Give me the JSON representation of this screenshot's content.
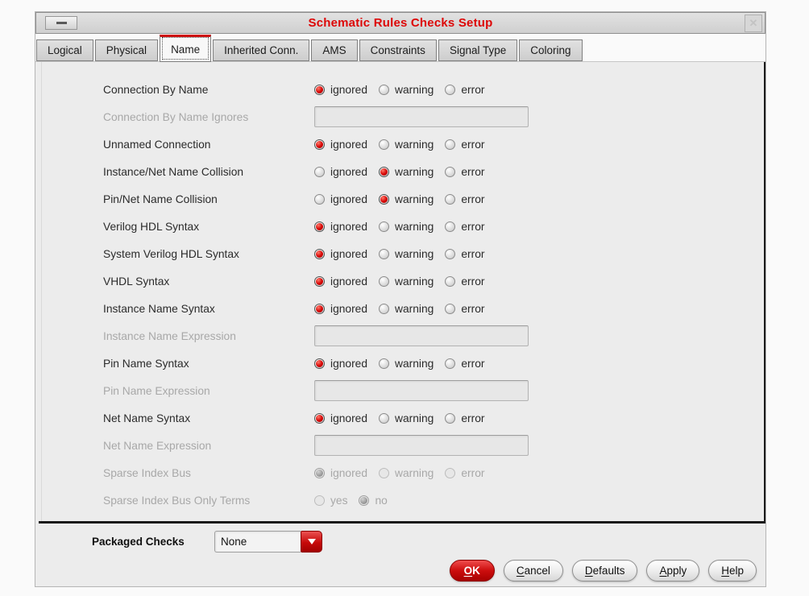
{
  "window": {
    "title": "Schematic Rules Checks Setup"
  },
  "icons": {
    "minimize": "–",
    "close": "✕",
    "dropdown_arrow": "▼"
  },
  "colors": {
    "accent_red": "#cc0000",
    "title_text": "#dd0707",
    "primary_button": "#c60909",
    "disabled_text": "#a8a8a8"
  },
  "tabs": [
    {
      "label": "Logical",
      "active": false
    },
    {
      "label": "Physical",
      "active": false
    },
    {
      "label": "Name",
      "active": true
    },
    {
      "label": "Inherited Conn.",
      "active": false
    },
    {
      "label": "AMS",
      "active": false
    },
    {
      "label": "Constraints",
      "active": false
    },
    {
      "label": "Signal Type",
      "active": false
    },
    {
      "label": "Coloring",
      "active": false
    }
  ],
  "severity_options": [
    "ignored",
    "warning",
    "error"
  ],
  "rows": [
    {
      "type": "radio",
      "label": "Connection By Name",
      "selected": "ignored",
      "enabled": true
    },
    {
      "type": "field",
      "label": "Connection By Name Ignores",
      "value": "",
      "enabled": false
    },
    {
      "type": "radio",
      "label": "Unnamed Connection",
      "selected": "ignored",
      "enabled": true
    },
    {
      "type": "radio",
      "label": "Instance/Net Name Collision",
      "selected": "warning",
      "enabled": true
    },
    {
      "type": "radio",
      "label": "Pin/Net Name Collision",
      "selected": "warning",
      "enabled": true
    },
    {
      "type": "radio",
      "label": "Verilog HDL Syntax",
      "selected": "ignored",
      "enabled": true
    },
    {
      "type": "radio",
      "label": "System Verilog HDL Syntax",
      "selected": "ignored",
      "enabled": true
    },
    {
      "type": "radio",
      "label": "VHDL Syntax",
      "selected": "ignored",
      "enabled": true
    },
    {
      "type": "radio",
      "label": "Instance Name Syntax",
      "selected": "ignored",
      "enabled": true
    },
    {
      "type": "field",
      "label": "Instance Name Expression",
      "value": "",
      "enabled": false
    },
    {
      "type": "radio",
      "label": "Pin Name Syntax",
      "selected": "ignored",
      "enabled": true
    },
    {
      "type": "field",
      "label": "Pin Name Expression",
      "value": "",
      "enabled": false
    },
    {
      "type": "radio",
      "label": "Net Name Syntax",
      "selected": "ignored",
      "enabled": true
    },
    {
      "type": "field",
      "label": "Net Name Expression",
      "value": "",
      "enabled": false
    },
    {
      "type": "radio",
      "label": "Sparse Index Bus",
      "selected": "ignored",
      "enabled": false
    },
    {
      "type": "radio",
      "label": "Sparse Index Bus Only Terms",
      "selected": "no",
      "enabled": false,
      "options": [
        "yes",
        "no"
      ]
    }
  ],
  "footer": {
    "packaged_checks_label": "Packaged Checks",
    "packaged_checks_value": "None",
    "buttons": [
      {
        "label": "OK",
        "mnemonic": "O",
        "primary": true
      },
      {
        "label": "Cancel",
        "mnemonic": "C",
        "primary": false
      },
      {
        "label": "Defaults",
        "mnemonic": "D",
        "primary": false
      },
      {
        "label": "Apply",
        "mnemonic": "A",
        "primary": false
      },
      {
        "label": "Help",
        "mnemonic": "H",
        "primary": false
      }
    ]
  }
}
